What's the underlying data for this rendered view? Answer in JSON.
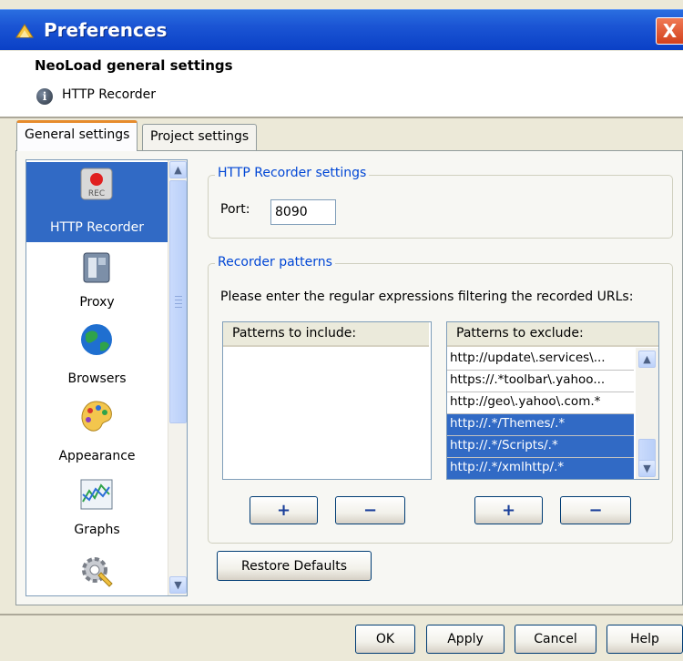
{
  "window": {
    "title": "Preferences",
    "close_label": "X"
  },
  "header": {
    "title": "NeoLoad general settings",
    "subtitle": "HTTP Recorder"
  },
  "tabs": [
    {
      "label": "General settings",
      "active": true
    },
    {
      "label": "Project settings",
      "active": false
    }
  ],
  "sidebar": {
    "items": [
      {
        "label": "HTTP Recorder",
        "icon": "rec-icon",
        "selected": true
      },
      {
        "label": "Proxy",
        "icon": "proxy-icon",
        "selected": false
      },
      {
        "label": "Browsers",
        "icon": "globe-icon",
        "selected": false
      },
      {
        "label": "Appearance",
        "icon": "palette-icon",
        "selected": false
      },
      {
        "label": "Graphs",
        "icon": "graph-icon",
        "selected": false
      },
      {
        "label": "",
        "icon": "gear-icon",
        "selected": false
      }
    ]
  },
  "recorder_settings": {
    "group_title": "HTTP Recorder settings",
    "port_label": "Port:",
    "port_value": "8090"
  },
  "recorder_patterns": {
    "group_title": "Recorder patterns",
    "instructions": "Please enter the regular expressions filtering the recorded URLs:",
    "include": {
      "header": "Patterns to include:",
      "rows": []
    },
    "exclude": {
      "header": "Patterns to exclude:",
      "rows": [
        {
          "text": "http://update\\.services\\...",
          "selected": false
        },
        {
          "text": "https://.*toolbar\\.yahoo...",
          "selected": false
        },
        {
          "text": "http://geo\\.yahoo\\.com.*",
          "selected": false
        },
        {
          "text": "http://.*/Themes/.*",
          "selected": true
        },
        {
          "text": "http://.*/Scripts/.*",
          "selected": true
        },
        {
          "text": "http://.*/xmlhttp/.*",
          "selected": true
        }
      ]
    },
    "add_label": "+",
    "remove_label": "−"
  },
  "restore_defaults_label": "Restore Defaults",
  "footer": {
    "ok_label": "OK",
    "apply_label": "Apply",
    "cancel_label": "Cancel",
    "help_label": "Help"
  }
}
